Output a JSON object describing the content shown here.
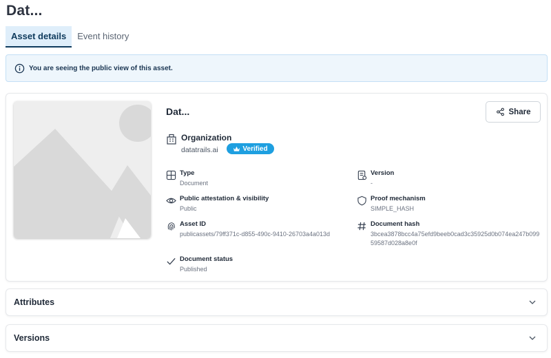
{
  "page": {
    "title": "Dat..."
  },
  "tabs": [
    {
      "label": "Asset details",
      "active": true
    },
    {
      "label": "Event history",
      "active": false
    }
  ],
  "banner": {
    "text": "You are seeing the public view of this asset.",
    "icon": "info-icon"
  },
  "asset": {
    "title": "Dat...",
    "share_label": "Share",
    "organization": {
      "label": "Organization",
      "name": "datatrails.ai",
      "badge": "Verified"
    },
    "fields": {
      "type": {
        "label": "Type",
        "value": "Document",
        "icon": "grid-icon"
      },
      "version": {
        "label": "Version",
        "value": "-",
        "icon": "document-version-icon"
      },
      "visibility": {
        "label": "Public attestation & visibility",
        "value": "Public",
        "icon": "eye-icon"
      },
      "proof": {
        "label": "Proof mechanism",
        "value": "SIMPLE_HASH",
        "icon": "shield-icon"
      },
      "asset_id": {
        "label": "Asset ID",
        "value": "publicassets/79ff371c-d855-490c-9410-26703a4a013d",
        "icon": "fingerprint-icon"
      },
      "doc_hash": {
        "label": "Document hash",
        "value": "3bcea3878bcc4a75efd9beeb0cad3c35925d0b074ea247b09959587d028a8e0f",
        "icon": "hash-icon"
      },
      "status": {
        "label": "Document status",
        "value": "Published",
        "icon": "check-icon"
      }
    }
  },
  "sections": [
    {
      "label": "Attributes"
    },
    {
      "label": "Versions"
    }
  ],
  "colors": {
    "accent": "#0e3a5c",
    "tab_active_bg": "#dfeefa",
    "banner_bg": "#eef6fc",
    "verified_badge": "#1e9fe0"
  }
}
